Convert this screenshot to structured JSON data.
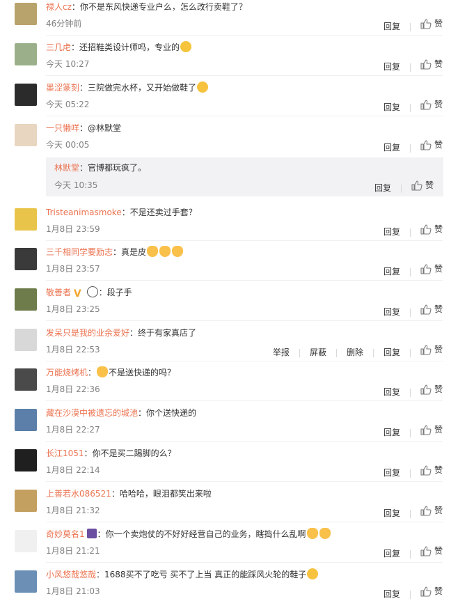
{
  "comments": [
    {
      "name": "禄人cz",
      "text": "你不是东风快递专业户么，怎么改行卖鞋了？",
      "time": "46分钟前",
      "avatar_color": "#b9a36c"
    },
    {
      "name": "三几虍",
      "text": "还招鞋类设计师吗，专业的",
      "time": "今天 10:27",
      "avatar_color": "#9bb08a"
    },
    {
      "name": "墨涩篆刻",
      "text": "三院做完水杯，又开始做鞋了",
      "time": "今天 05:22",
      "avatar_color": "#2b2b2b"
    },
    {
      "name": "一只懒咩",
      "text": "@林默堂",
      "time": "今天 00:05",
      "avatar_color": "#e8d6c0"
    },
    {
      "name": "Tristeanimasmoke",
      "text": "不是还卖过手套？",
      "time": "1月8日 23:59",
      "avatar_color": "#e9c44a"
    },
    {
      "name": "三千相同学要励志",
      "text": "真是皮",
      "time": "1月8日 23:57",
      "avatar_color": "#3a3a3a"
    },
    {
      "name": "敬善者",
      "text": "：段子手",
      "time": "1月8日 23:25",
      "avatar_color": "#6d7c4a"
    },
    {
      "name": "发呆只是我的业余爱好",
      "text": "终于有家真店了",
      "time": "1月8日 22:53",
      "avatar_color": "#d8d8d8"
    },
    {
      "name": "万能烧烤机",
      "text": "不是送快递的吗？",
      "time": "1月8日 22:36",
      "avatar_color": "#4a4a4a"
    },
    {
      "name": "藏在沙漠中被遗忘的城池",
      "text": "你个送快递的",
      "time": "1月8日 22:27",
      "avatar_color": "#5b7fa8"
    },
    {
      "name": "长江1051",
      "text": "你不是买二踢脚的么？",
      "time": "1月8日 22:14",
      "avatar_color": "#1f1f1f"
    },
    {
      "name": "上善若水086521",
      "text": "哈哈哈，眼泪都笑出来啦",
      "time": "1月8日 21:32",
      "avatar_color": "#c4a060"
    },
    {
      "name": "奇妙莫名1",
      "text": "你一个卖炮仗的不好好经营自己的业务，瞎捣什么乱啊",
      "time": "1月8日 21:21",
      "avatar_color": "#f0f0f0"
    },
    {
      "name": "小风悠哉悠哉",
      "text": "1688买不了吃亏 买不了上当 真正的能踩风火轮的鞋子",
      "time": "1月8日 21:03",
      "avatar_color": "#6b8fb5"
    }
  ],
  "reply": {
    "name": "林默堂",
    "text": "官博都玩疯了。",
    "time": "今天 10:35"
  },
  "labels": {
    "reply": "回复",
    "like": "赞",
    "report": "举报",
    "block": "屏蔽",
    "delete": "删除",
    "colon": "："
  },
  "colors": {
    "name": "#eb7350",
    "time": "#808080",
    "reply_bg": "#f2f2f5"
  }
}
